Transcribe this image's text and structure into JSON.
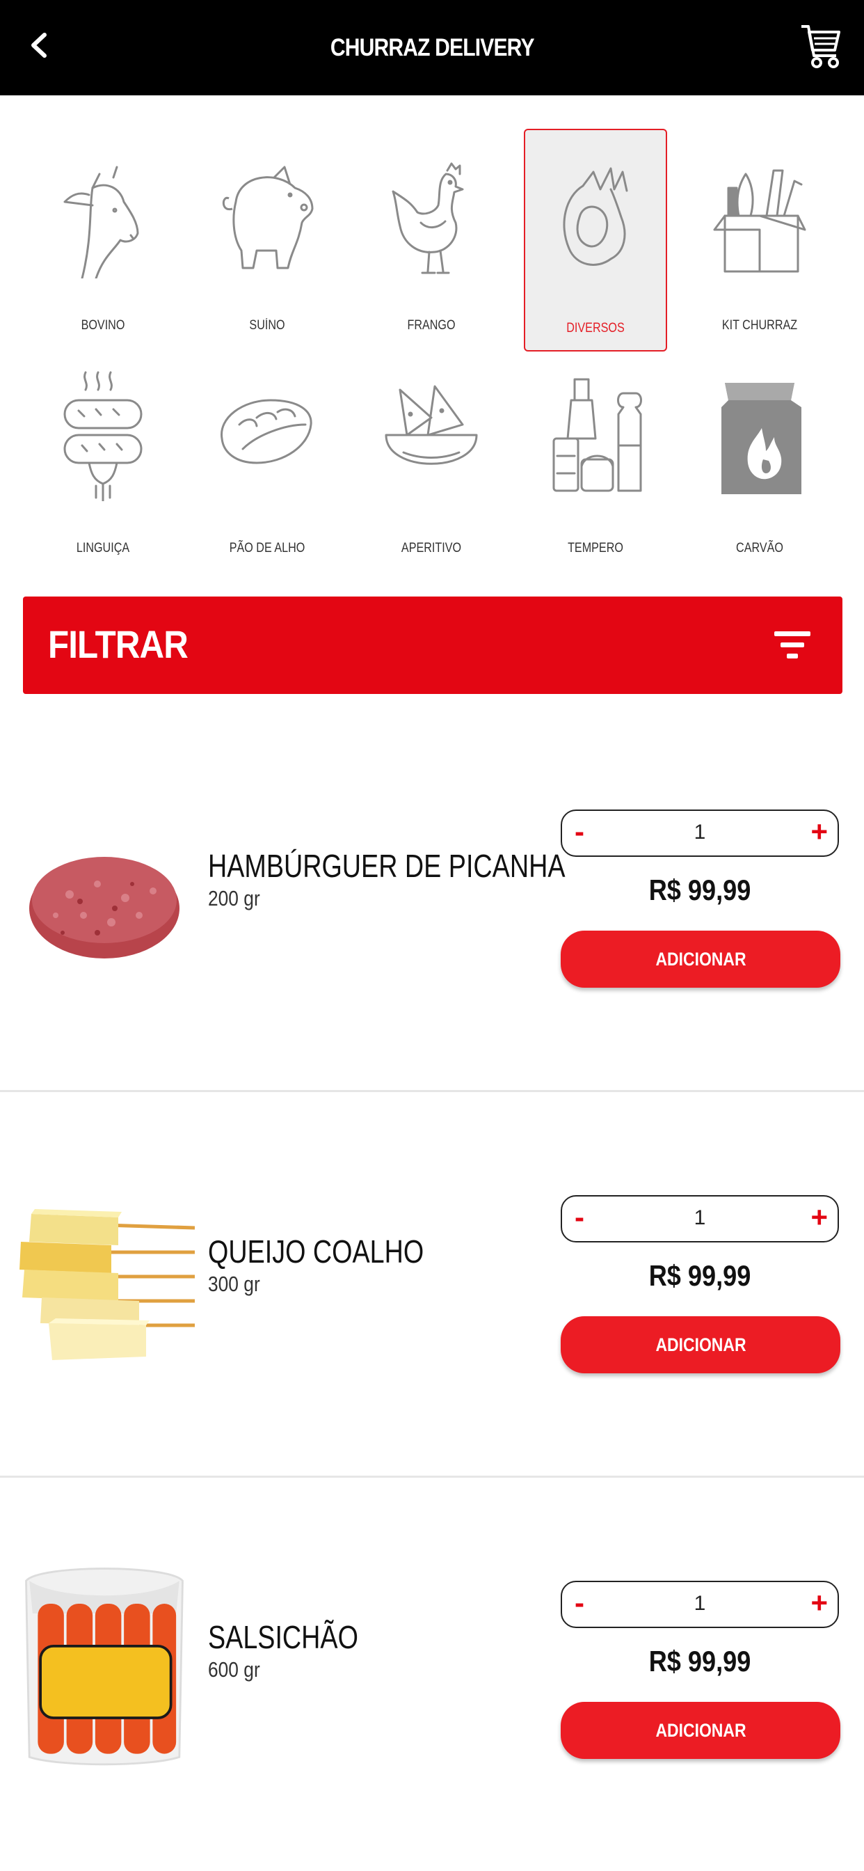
{
  "header": {
    "title": "CHURRAZ DELIVERY"
  },
  "categories": [
    {
      "label": "BOVINO",
      "icon": "cow-icon"
    },
    {
      "label": "SUÍNO",
      "icon": "pig-icon"
    },
    {
      "label": "FRANGO",
      "icon": "chicken-icon"
    },
    {
      "label": "DIVERSOS",
      "icon": "meat-cut-icon",
      "selected": true
    },
    {
      "label": "KIT CHURRAZ",
      "icon": "grocery-box-icon"
    },
    {
      "label": "LINGUIÇA",
      "icon": "sausage-icon"
    },
    {
      "label": "PÃO DE ALHO",
      "icon": "garlic-bread-icon"
    },
    {
      "label": "APERITIVO",
      "icon": "nachos-bowl-icon"
    },
    {
      "label": "TEMPERO",
      "icon": "spices-icon"
    },
    {
      "label": "CARVÃO",
      "icon": "charcoal-bag-icon"
    }
  ],
  "filter": {
    "label": "FILTRAR",
    "icon": "filter-icon"
  },
  "products": [
    {
      "name": "HAMBÚRGUER DE PICANHA",
      "weight": "200 gr",
      "qty": "1",
      "price": "R$ 99,99",
      "add_label": "ADICIONAR",
      "minus": "-",
      "plus": "+"
    },
    {
      "name": "QUEIJO COALHO",
      "weight": "300 gr",
      "qty": "1",
      "price": "R$ 99,99",
      "add_label": "ADICIONAR",
      "minus": "-",
      "plus": "+"
    },
    {
      "name": "SALSICHÃO",
      "weight": "600 gr",
      "qty": "1",
      "price": "R$ 99,99",
      "add_label": "ADICIONAR",
      "minus": "-",
      "plus": "+"
    }
  ],
  "colors": {
    "accent": "#e30613",
    "header_bg": "#000000",
    "selected_bg": "#eeeeee"
  }
}
